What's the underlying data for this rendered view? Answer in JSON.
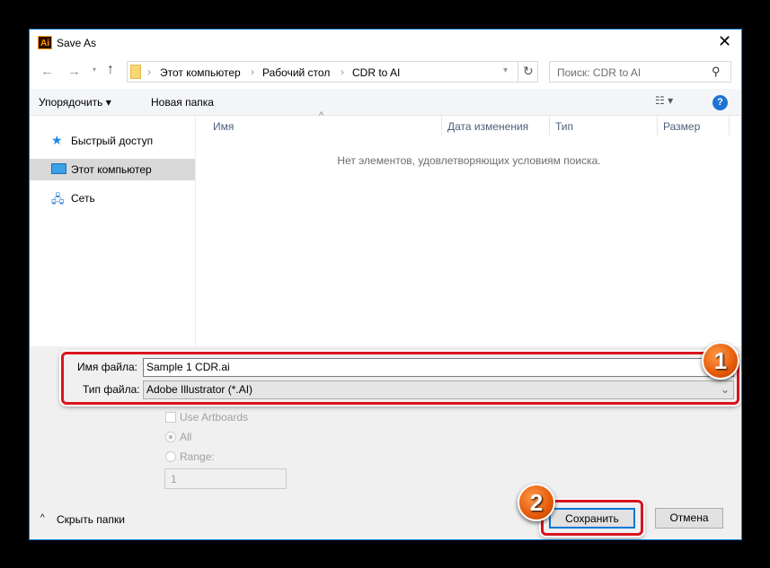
{
  "window": {
    "title": "Save As",
    "app_icon": "Ai"
  },
  "nav": {
    "breadcrumb": [
      "Этот компьютер",
      "Рабочий стол",
      "CDR to AI"
    ],
    "search_placeholder": "Поиск: CDR to AI"
  },
  "toolbar": {
    "organize": "Упорядочить ▾",
    "new_folder": "Новая папка",
    "help": "?"
  },
  "sidebar": {
    "items": [
      {
        "label": "Быстрый доступ",
        "icon": "star-icon"
      },
      {
        "label": "Этот компьютер",
        "icon": "computer-icon",
        "selected": true
      },
      {
        "label": "Сеть",
        "icon": "network-icon"
      }
    ]
  },
  "list": {
    "columns": [
      "Имя",
      "Дата изменения",
      "Тип",
      "Размер"
    ],
    "empty_message": "Нет элементов, удовлетворяющих условиям поиска."
  },
  "form": {
    "filename_label": "Имя файла:",
    "filename_value": "Sample 1 CDR.ai",
    "filetype_label": "Тип файла:",
    "filetype_value": "Adobe Illustrator (*.AI)"
  },
  "options": {
    "use_artboards": "Use Artboards",
    "all": "All",
    "range": "Range:",
    "range_value": "1"
  },
  "footer": {
    "hide_folders": "Скрыть папки",
    "save": "Сохранить",
    "cancel": "Отмена"
  },
  "badges": [
    "1",
    "2"
  ]
}
